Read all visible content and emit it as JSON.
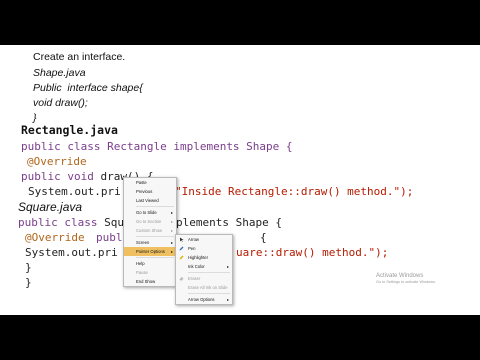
{
  "slide": {
    "intro": [
      "Create an interface.",
      "Shape.java",
      "Public  interface shape{",
      "void draw();",
      "}"
    ],
    "rect_heading": "Rectangle.java",
    "rect_code": {
      "l1_kw": "public class",
      "l1_rest": " Rectangle implements Shape {",
      "l2": "@Override",
      "l3_kw": "public void",
      "l3_rest": " draw() {",
      "l4a": "System.out.pri",
      "l4b": "\"Inside Rectangle::draw() method.\");"
    },
    "square_heading": "Square.java",
    "square_code": {
      "l1_kw": "public class",
      "l1a": " Squ",
      "l1b": "plements Shape {",
      "l2": "@Override",
      "l2b": "publ",
      "l2c": "{",
      "l3a": "System.out.pri",
      "l3b": "uare::draw() method.\");",
      "l4": "}",
      "l5": "}"
    }
  },
  "context_menu": {
    "items": [
      {
        "label": "Paste",
        "disabled": false
      },
      {
        "label": "Previous",
        "disabled": false
      },
      {
        "label": "Last Viewed",
        "disabled": false
      },
      {
        "label": "Go to Slide",
        "disabled": false,
        "submenu": true
      },
      {
        "label": "Go to Section",
        "disabled": true,
        "submenu": true
      },
      {
        "label": "Custom Show",
        "disabled": true,
        "submenu": true
      },
      {
        "label": "Screen",
        "disabled": false,
        "submenu": true
      },
      {
        "label": "Pointer Options",
        "disabled": false,
        "submenu": true,
        "highlighted": true
      },
      {
        "label": "Help",
        "disabled": false
      },
      {
        "label": "Pause",
        "disabled": true
      },
      {
        "label": "End Show",
        "disabled": false
      }
    ]
  },
  "submenu": {
    "items": [
      {
        "label": "Arrow",
        "icon": "arrow-icon",
        "disabled": false
      },
      {
        "label": "Pen",
        "icon": "pen-icon",
        "disabled": false
      },
      {
        "label": "Highlighter",
        "icon": "highlighter-icon",
        "disabled": false
      },
      {
        "label": "Ink Color",
        "icon": "",
        "disabled": false,
        "submenu": true
      },
      {
        "label": "Eraser",
        "icon": "eraser-icon",
        "disabled": true
      },
      {
        "label": "Erase All Ink on Slide",
        "icon": "",
        "disabled": true
      },
      {
        "label": "Arrow Options",
        "icon": "",
        "disabled": false,
        "submenu": true
      }
    ]
  },
  "watermark": {
    "title": "Activate Windows",
    "subtitle": "Go to Settings to activate Windows."
  },
  "colors": {
    "keyword": "#7a3e8c",
    "annotation": "#b0661c",
    "string": "#b51a00",
    "highlight": "#f0c060"
  }
}
